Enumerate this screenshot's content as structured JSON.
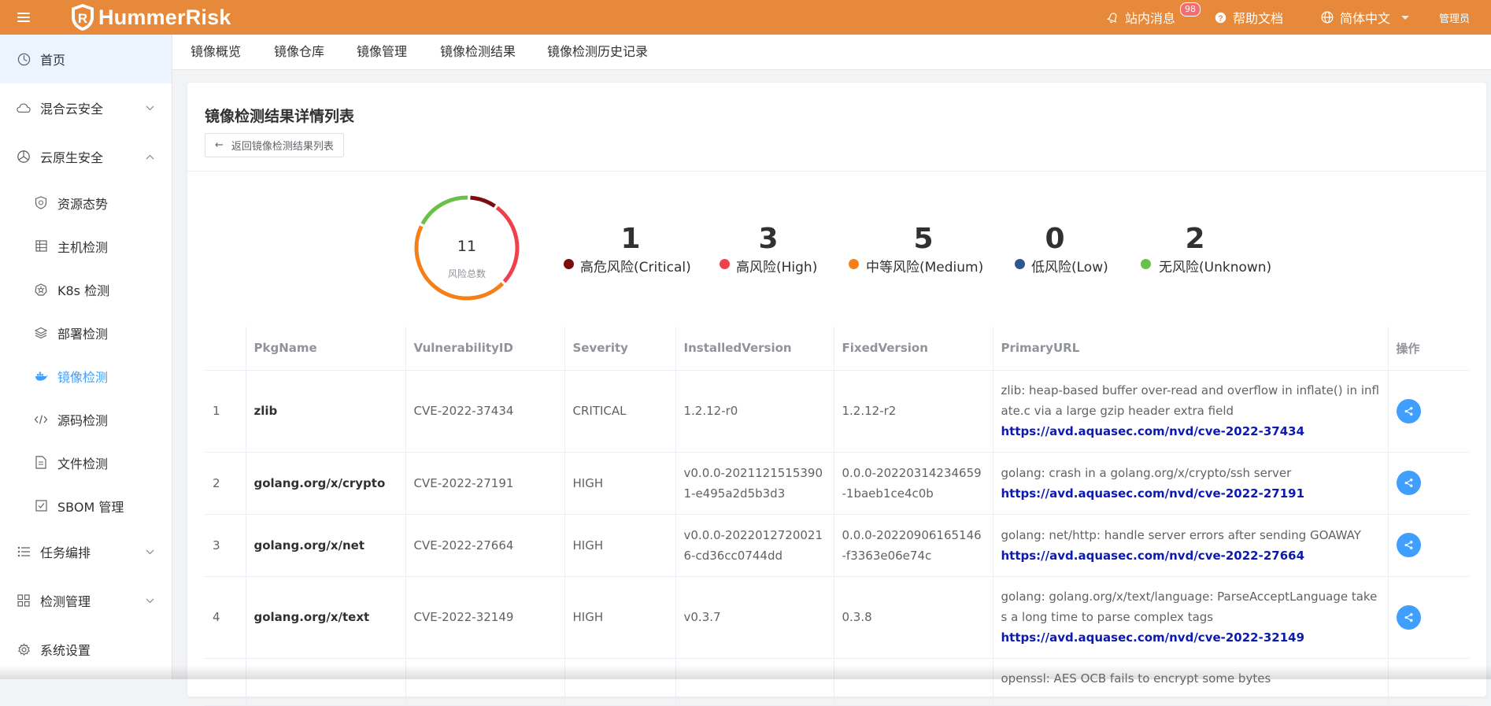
{
  "app": {
    "name": "HummerRisk",
    "colors": {
      "brand": "#e6893a",
      "accent": "#409eff"
    }
  },
  "header": {
    "messages_label": "站内消息",
    "messages_count": "98",
    "help_label": "帮助文档",
    "language_label": "简体中文",
    "user_label": "管理员"
  },
  "sidebar": {
    "home": "首页",
    "hybrid_cloud": "混合云安全",
    "cloud_native": "云原生安全",
    "items": [
      {
        "label": "资源态势",
        "icon": "shield-icon"
      },
      {
        "label": "主机检测",
        "icon": "server-icon"
      },
      {
        "label": "K8s 检测",
        "icon": "k8s-icon"
      },
      {
        "label": "部署检测",
        "icon": "layers-icon"
      },
      {
        "label": "镜像检测",
        "icon": "docker-icon"
      },
      {
        "label": "源码检测",
        "icon": "code-icon"
      },
      {
        "label": "文件检测",
        "icon": "file-icon"
      },
      {
        "label": "SBOM 管理",
        "icon": "checkbox-icon"
      }
    ],
    "task_orchestration": "任务编排",
    "detection_mgmt": "检测管理",
    "system_settings": "系统设置"
  },
  "subtabs": [
    "镜像概览",
    "镜像仓库",
    "镜像管理",
    "镜像检测结果",
    "镜像检测历史记录"
  ],
  "main": {
    "title": "镜像检测结果详情列表",
    "back_button": "返回镜像检测结果列表",
    "summary": {
      "total": "11",
      "total_label": "风险总数",
      "stats": [
        {
          "count": "1",
          "label": "高危风险(Critical)",
          "color": "#7d0d0d"
        },
        {
          "count": "3",
          "label": "高风险(High)",
          "color": "#f0414a"
        },
        {
          "count": "5",
          "label": "中等风险(Medium)",
          "color": "#f5801a"
        },
        {
          "count": "0",
          "label": "低风险(Low)",
          "color": "#2e5597"
        },
        {
          "count": "2",
          "label": "无风险(Unknown)",
          "color": "#6cc04a"
        }
      ]
    },
    "table": {
      "columns": [
        "",
        "PkgName",
        "VulnerabilityID",
        "Severity",
        "InstalledVersion",
        "FixedVersion",
        "PrimaryURL",
        "操作"
      ],
      "rows": [
        {
          "index": "1",
          "pkg": "zlib",
          "cve": "CVE-2022-37434",
          "severity": "CRITICAL",
          "installed": "1.2.12-r0",
          "fixed": "1.2.12-r2",
          "desc": "zlib: heap-based buffer over-read and overflow in inflate() in inflate.c via a large gzip header extra field",
          "url": "https://avd.aquasec.com/nvd/cve-2022-37434"
        },
        {
          "index": "2",
          "pkg": "golang.org/x/crypto",
          "cve": "CVE-2022-27191",
          "severity": "HIGH",
          "installed": "v0.0.0-20211215153901-e495a2d5b3d3",
          "fixed": "0.0.0-20220314234659-1baeb1ce4c0b",
          "desc": "golang: crash in a golang.org/x/crypto/ssh server",
          "url": "https://avd.aquasec.com/nvd/cve-2022-27191"
        },
        {
          "index": "3",
          "pkg": "golang.org/x/net",
          "cve": "CVE-2022-27664",
          "severity": "HIGH",
          "installed": "v0.0.0-20220127200216-cd36cc0744dd",
          "fixed": "0.0.0-20220906165146-f3363e06e74c",
          "desc": "golang: net/http: handle server errors after sending GOAWAY",
          "url": "https://avd.aquasec.com/nvd/cve-2022-27664"
        },
        {
          "index": "4",
          "pkg": "golang.org/x/text",
          "cve": "CVE-2022-32149",
          "severity": "HIGH",
          "installed": "v0.3.7",
          "fixed": "0.3.8",
          "desc": "golang: golang.org/x/text/language: ParseAcceptLanguage takes a long time to parse complex tags",
          "url": "https://avd.aquasec.com/nvd/cve-2022-32149"
        },
        {
          "index": "",
          "pkg": "",
          "cve": "",
          "severity": "",
          "installed": "",
          "fixed": "",
          "desc": "openssl: AES OCB fails to encrypt some bytes",
          "url": ""
        }
      ]
    }
  }
}
